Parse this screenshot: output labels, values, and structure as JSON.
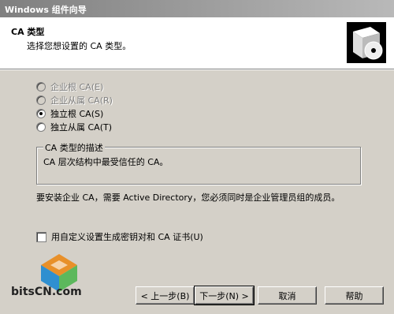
{
  "window": {
    "title": "Windows 组件向导"
  },
  "header": {
    "title": "CA 类型",
    "subtitle": "选择您想设置的 CA 类型。",
    "icon": "setup-box-cd-icon"
  },
  "ca_types": [
    {
      "label": "企业根 CA(E)",
      "selected": false,
      "enabled": false
    },
    {
      "label": "企业从属 CA(R)",
      "selected": false,
      "enabled": false
    },
    {
      "label": "独立根 CA(S)",
      "selected": true,
      "enabled": true
    },
    {
      "label": "独立从属 CA(T)",
      "selected": false,
      "enabled": true
    }
  ],
  "description": {
    "legend": "CA 类型的描述",
    "text": "CA 层次结构中最受信任的 CA。"
  },
  "notice": "要安装企业 CA，需要 Active Directory，您必须同时是企业管理员组的成员。",
  "custom_keys": {
    "label": "用自定义设置生成密钥对和 CA 证书(U)",
    "checked": false
  },
  "watermark": {
    "text": "bitsCN.com"
  },
  "buttons": {
    "back": "< 上一步(B)",
    "next": "下一步(N) >",
    "cancel": "取消",
    "help": "帮助"
  }
}
